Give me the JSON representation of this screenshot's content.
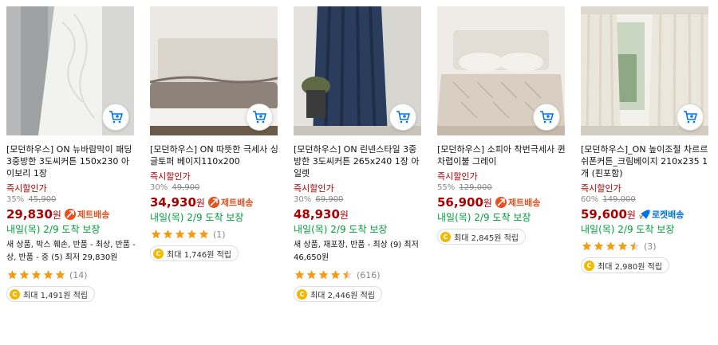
{
  "products": [
    {
      "title": "[모던하우스] ON 뉴바람막이 패딩 3중방한 3도씨커튼 150x230 아이보리 1장",
      "discount_label": "즉시할인가",
      "discount_pct": "35%",
      "original_price": "45,900",
      "price": "29,830",
      "won": "원",
      "badge": "제트배송",
      "delivery": "내일(목) 2/9 도착 보장",
      "extra_text": "새 상품, 박스 훼손, 반품 - 최상, 반품 - 상, 반품 - 중 (5) 최저 29,830원",
      "rating": 5,
      "rating_count": "(14)",
      "cashback": "최대 1,491원 적립"
    },
    {
      "title": "[모던하우스] ON 따뜻한 극세사 싱글토퍼 베이지110x200",
      "discount_label": "즉시할인가",
      "discount_pct": "30%",
      "original_price": "49,900",
      "price": "34,930",
      "won": "원",
      "badge": "제트배송",
      "delivery": "내일(목) 2/9 도착 보장",
      "extra_text": "",
      "rating": 5,
      "rating_count": "(1)",
      "cashback": "최대 1,746원 적립"
    },
    {
      "title": "[모던하우스] ON 린넨스타일 3중방한 3도씨커튼 265x240 1장 아일렛",
      "discount_label": "즉시할인가",
      "discount_pct": "30%",
      "original_price": "69,900",
      "price": "48,930",
      "won": "원",
      "badge": "",
      "delivery": "내일(목) 2/9 도착 보장",
      "extra_text": "새 상품, 재포장, 반품 - 최상 (9) 최저 46,650원",
      "rating": 4.5,
      "rating_count": "(616)",
      "cashback": "최대 2,446원 적립"
    },
    {
      "title": "[모던하우스] 소피아 착번극세사 퀸 차렵이불 그레이",
      "discount_label": "즉시할인가",
      "discount_pct": "55%",
      "original_price": "129,000",
      "price": "56,900",
      "won": "원",
      "badge": "제트배송",
      "delivery": "내일(목) 2/9 도착 보장",
      "extra_text": "",
      "rating": 0,
      "rating_count": "",
      "cashback": "최대 2,845원 적립"
    },
    {
      "title": "[모던하우스]_ON 높이조절 차르르 쉬폰커튼_크림베이지 210x235 1개 (핀포함)",
      "discount_label": "즉시할인가",
      "discount_pct": "60%",
      "original_price": "149,000",
      "price": "59,600",
      "won": "원",
      "badge": "로켓배송",
      "delivery": "내일(목) 2/9 도착 보장",
      "extra_text": "",
      "rating": 4.5,
      "rating_count": "(3)",
      "cashback": "최대 2,980원 적립"
    }
  ],
  "colors": {
    "price_red": "#ae0000",
    "delivery_green": "#009e3a",
    "jet_orange": "#e8501f",
    "rocket_blue": "#0073e9",
    "star": "#f39c12"
  },
  "icons": {
    "cart": "cart-plus-icon",
    "jet": "jet-delivery-icon",
    "rocket": "rocket-delivery-icon",
    "star": "star-icon",
    "coin": "coin-icon"
  }
}
